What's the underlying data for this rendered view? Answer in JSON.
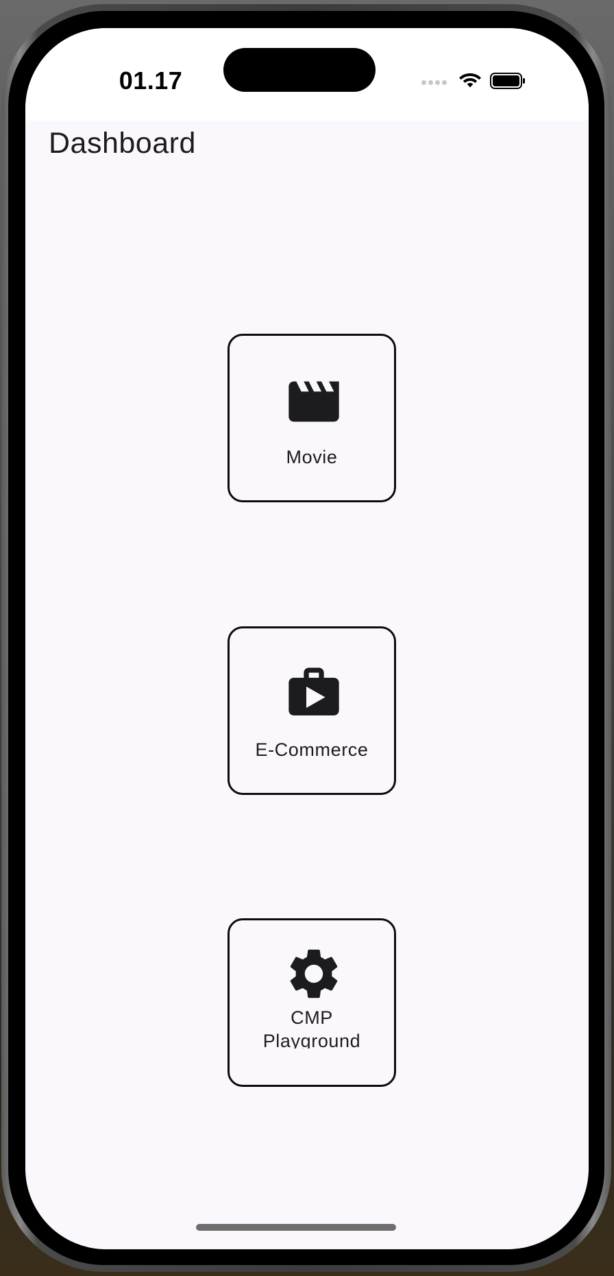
{
  "status_bar": {
    "time": "01.17"
  },
  "header": {
    "title": "Dashboard"
  },
  "tiles": [
    {
      "label": "Movie",
      "icon": "movie-clapperboard-icon"
    },
    {
      "label": "E-Commerce",
      "icon": "shopping-bag-play-icon"
    },
    {
      "label_line1": "CMP",
      "label_line2": "Playground",
      "icon": "settings-gear-icon"
    }
  ],
  "colors": {
    "background": "#fbf8fd",
    "text": "#1c1b1f",
    "border": "#0c0c0c"
  }
}
